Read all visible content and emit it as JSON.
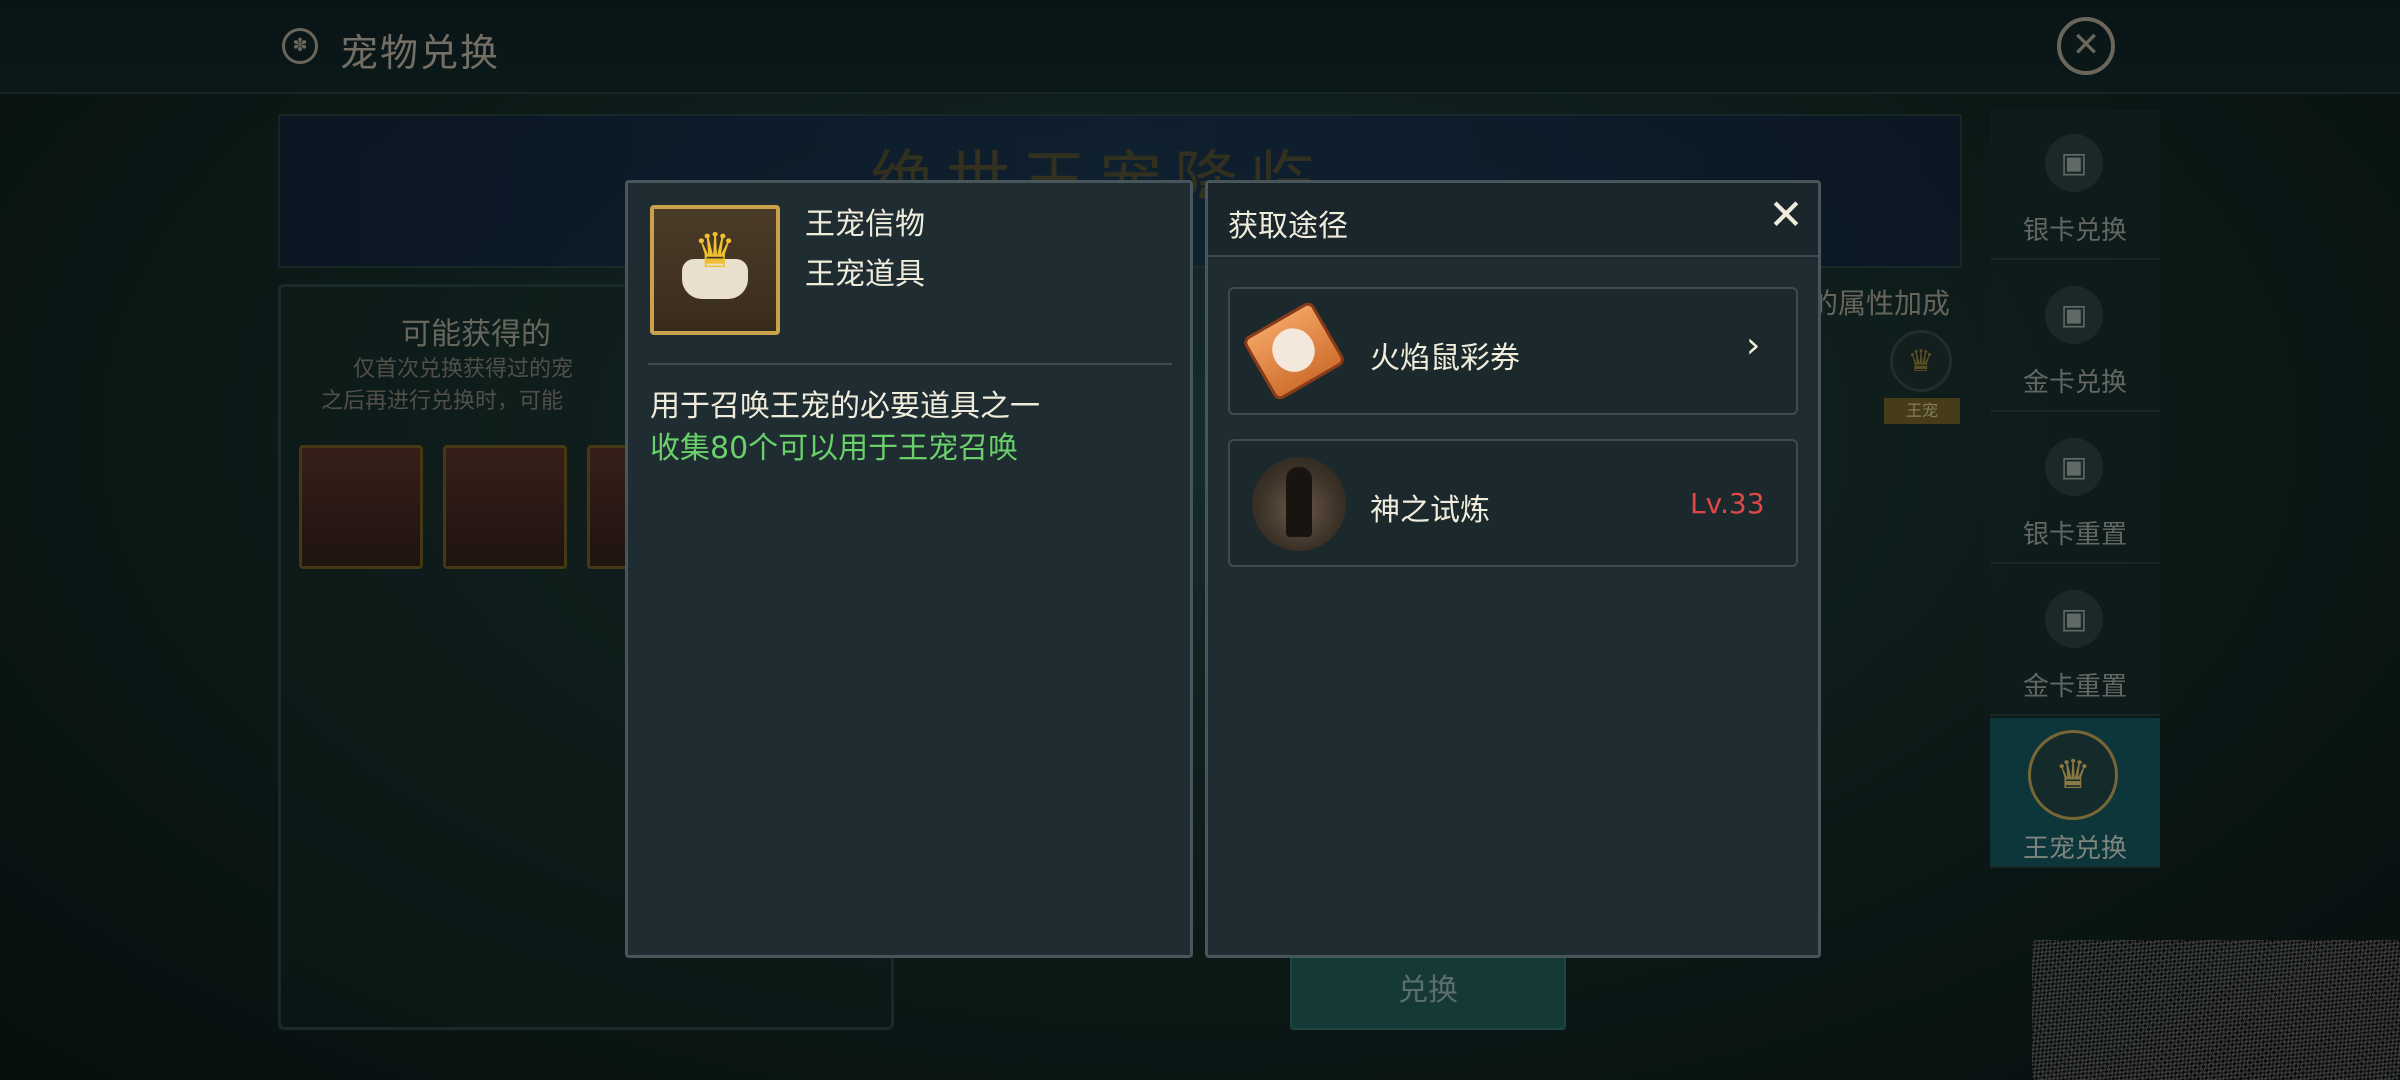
{
  "screen": {
    "title": "宠物兑换",
    "banner_text": "绝世王宠降临",
    "possible_label": "可能获得的",
    "note_line1": "仅首次兑换获得过的宠",
    "note_line2": "之后再进行兑换时，可能",
    "attr_label": "的属性加成",
    "attr_tag": "王宠",
    "exchange_button": "兑换"
  },
  "sidebar": {
    "items": [
      {
        "label": "银卡兑换",
        "icon": "card-icon"
      },
      {
        "label": "金卡兑换",
        "icon": "card-icon"
      },
      {
        "label": "银卡重置",
        "icon": "card-icon"
      },
      {
        "label": "金卡重置",
        "icon": "card-icon"
      },
      {
        "label": "王宠兑换",
        "icon": "crown-icon",
        "active": true
      }
    ]
  },
  "item_dialog": {
    "name": "王宠信物",
    "type": "王宠道具",
    "description": "用于召唤王宠的必要道具之一",
    "hint": "收集80个可以用于王宠召唤",
    "icon": "crown-scroll-icon"
  },
  "source_dialog": {
    "title": "获取途径",
    "rows": [
      {
        "label": "火焰鼠彩券",
        "icon": "ticket-icon"
      },
      {
        "label": "神之试炼",
        "level": "Lv.33",
        "icon": "trial-icon"
      }
    ]
  },
  "colors": {
    "hint_green": "#6ad06a",
    "level_red": "#e04848",
    "frame_gold": "#c9a24a"
  }
}
